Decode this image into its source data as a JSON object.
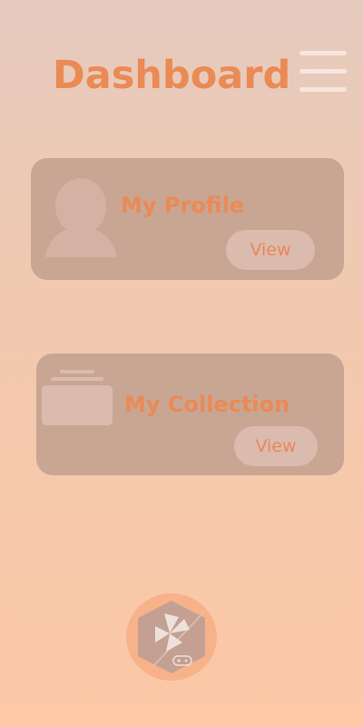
{
  "header": {
    "title": "Dashboard",
    "menu_icon": "hamburger-menu-icon"
  },
  "cards": [
    {
      "title": "My Profile",
      "action_label": "View",
      "icon": "user-avatar-icon"
    },
    {
      "title": "My Collection",
      "action_label": "View",
      "icon": "card-stack-icon"
    }
  ],
  "footer": {
    "logo_icon": "pinwheel-gamepad-logo-icon"
  },
  "colors": {
    "background_top": "#e6cabe",
    "background_bottom": "#fcc8a6",
    "accent": "#ea8a55",
    "card": "#c9a593",
    "button": "#dbbbae"
  }
}
